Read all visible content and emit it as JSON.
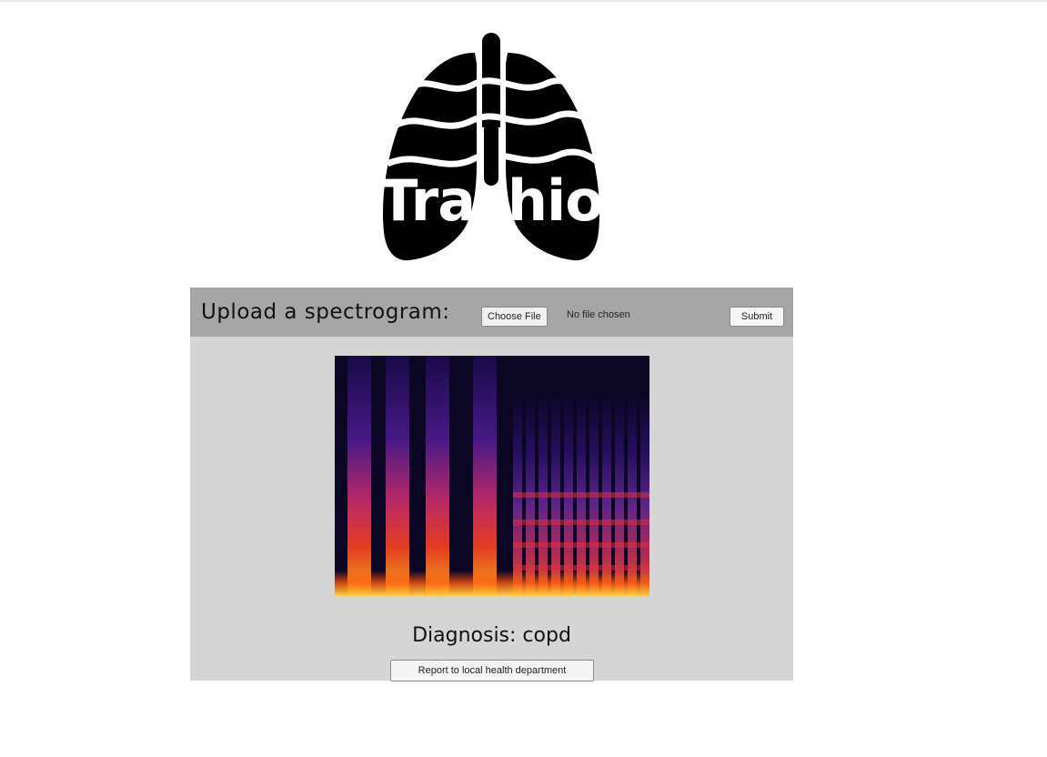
{
  "brand": {
    "logo_name": "lungs-logo-icon",
    "wordmark": "Trachio"
  },
  "upload": {
    "label": "Upload a spectrogram:",
    "choose_file_label": "Choose File",
    "file_status": "No file chosen",
    "submit_label": "Submit"
  },
  "result": {
    "spectrogram_icon": "spectrogram-image",
    "diagnosis_label": "Diagnosis:",
    "diagnosis_value": "copd",
    "diagnosis_text": "Diagnosis: copd",
    "report_label": "Report to local health department"
  },
  "colors": {
    "panel_bg": "#d5d5d5",
    "header_bg": "#a6a6a6",
    "logo_fill": "#000000"
  }
}
